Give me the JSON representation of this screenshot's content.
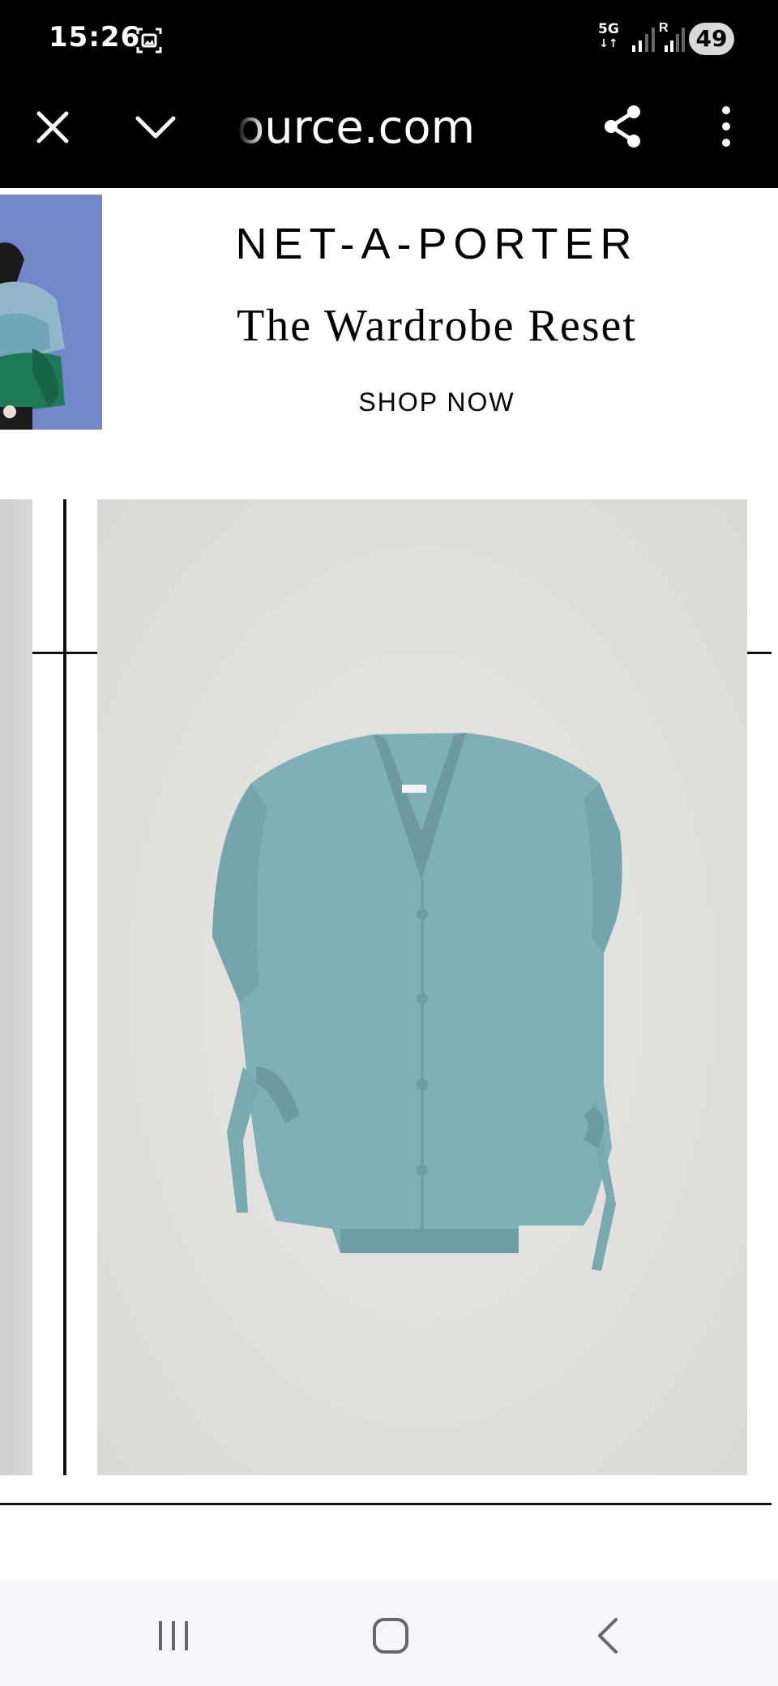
{
  "status_bar": {
    "time": "15:26",
    "network_type": "5G",
    "roaming_indicator": "R",
    "battery_level": "49",
    "icons": [
      "screenshot-icon",
      "signal-strength-icon",
      "signal-strength-roaming-icon"
    ]
  },
  "browser_toolbar": {
    "url_text": "ource.com",
    "icons": [
      "close-icon",
      "chevron-down-icon",
      "share-icon",
      "more-vertical-icon"
    ]
  },
  "ad_banner": {
    "brand": "NET-A-PORTER",
    "headline": "The Wardrobe Reset",
    "cta_label": "SHOP NOW"
  },
  "product_gallery": {
    "main_image": "blue-knitted-cardigan-vest-image",
    "previous_image": "previous-product-image"
  },
  "nav_bar": {
    "icons": [
      "recent-apps-icon",
      "home-icon",
      "back-icon"
    ]
  },
  "colors": {
    "status_bar_bg": "#000000",
    "product_color": "#7fb0b6",
    "product_bg": "#e3e1de",
    "nav_bar_bg": "#f5f5fa"
  }
}
